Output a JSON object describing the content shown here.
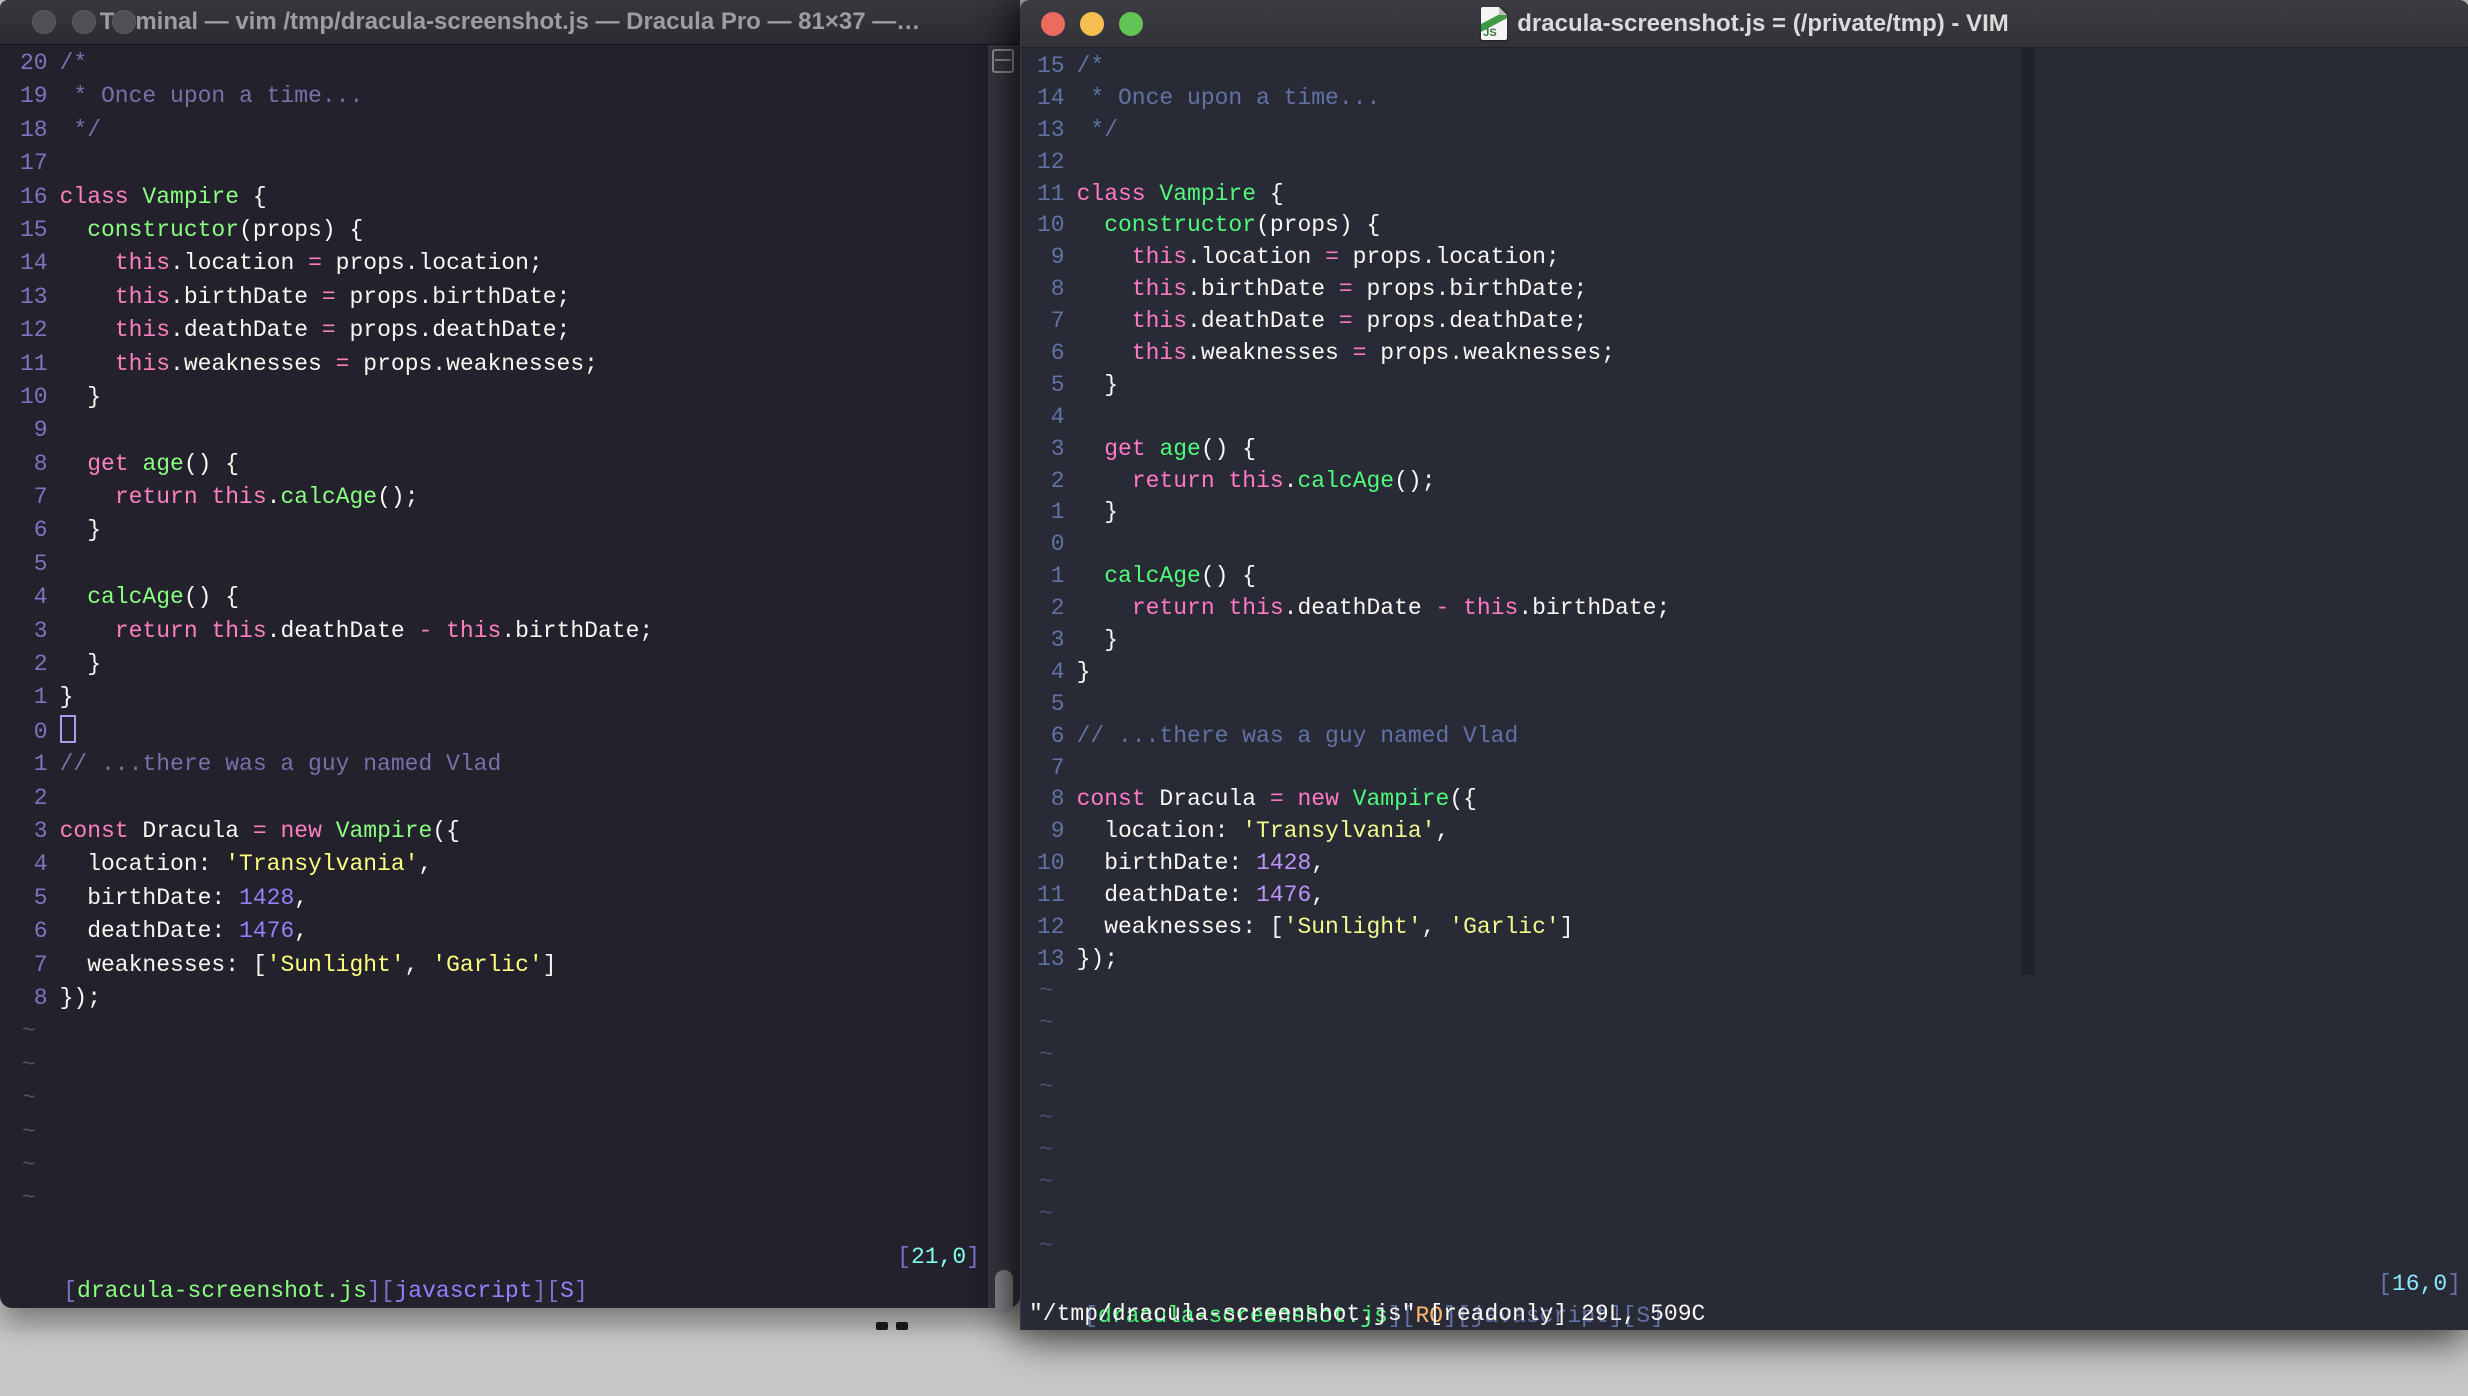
{
  "desktop": {
    "background_color": "#C9C7C5"
  },
  "shared_code": {
    "lines": [
      [
        [
          "comment",
          "/*"
        ]
      ],
      [
        [
          "comment",
          " * Once upon a time..."
        ]
      ],
      [
        [
          "comment",
          " */"
        ]
      ],
      [],
      [
        [
          "kw",
          "class"
        ],
        [
          "fg",
          " "
        ],
        [
          "fn",
          "Vampire"
        ],
        [
          "fg",
          " {"
        ]
      ],
      [
        [
          "fg",
          "  "
        ],
        [
          "fn",
          "constructor"
        ],
        [
          "fg",
          "(props) {"
        ]
      ],
      [
        [
          "fg",
          "    "
        ],
        [
          "kw",
          "this"
        ],
        [
          "fg",
          ".location "
        ],
        [
          "kw",
          "="
        ],
        [
          "fg",
          " props.location;"
        ]
      ],
      [
        [
          "fg",
          "    "
        ],
        [
          "kw",
          "this"
        ],
        [
          "fg",
          ".birthDate "
        ],
        [
          "kw",
          "="
        ],
        [
          "fg",
          " props.birthDate;"
        ]
      ],
      [
        [
          "fg",
          "    "
        ],
        [
          "kw",
          "this"
        ],
        [
          "fg",
          ".deathDate "
        ],
        [
          "kw",
          "="
        ],
        [
          "fg",
          " props.deathDate;"
        ]
      ],
      [
        [
          "fg",
          "    "
        ],
        [
          "kw",
          "this"
        ],
        [
          "fg",
          ".weaknesses "
        ],
        [
          "kw",
          "="
        ],
        [
          "fg",
          " props.weaknesses;"
        ]
      ],
      [
        [
          "fg",
          "  }"
        ]
      ],
      [],
      [
        [
          "fg",
          "  "
        ],
        [
          "kw",
          "get"
        ],
        [
          "fg",
          " "
        ],
        [
          "fn",
          "age"
        ],
        [
          "fg",
          "() {"
        ]
      ],
      [
        [
          "fg",
          "    "
        ],
        [
          "kw",
          "return"
        ],
        [
          "fg",
          " "
        ],
        [
          "kw",
          "this"
        ],
        [
          "fg",
          "."
        ],
        [
          "fn",
          "calcAge"
        ],
        [
          "fg",
          "();"
        ]
      ],
      [
        [
          "fg",
          "  }"
        ]
      ],
      [],
      [
        [
          "fg",
          "  "
        ],
        [
          "fn",
          "calcAge"
        ],
        [
          "fg",
          "() {"
        ]
      ],
      [
        [
          "fg",
          "    "
        ],
        [
          "kw",
          "return"
        ],
        [
          "fg",
          " "
        ],
        [
          "kw",
          "this"
        ],
        [
          "fg",
          ".deathDate "
        ],
        [
          "kw",
          "-"
        ],
        [
          "fg",
          " "
        ],
        [
          "kw",
          "this"
        ],
        [
          "fg",
          ".birthDate;"
        ]
      ],
      [
        [
          "fg",
          "  }"
        ]
      ],
      [
        [
          "fg",
          "}"
        ]
      ],
      [],
      [
        [
          "comment",
          "// ...there was a guy named Vlad"
        ]
      ],
      [],
      [
        [
          "kw",
          "const"
        ],
        [
          "fg",
          " Dracula "
        ],
        [
          "kw",
          "="
        ],
        [
          "fg",
          " "
        ],
        [
          "kw",
          "new"
        ],
        [
          "fg",
          " "
        ],
        [
          "fn",
          "Vampire"
        ],
        [
          "fg",
          "({"
        ]
      ],
      [
        [
          "fg",
          "  location: "
        ],
        [
          "str",
          "'Transylvania'"
        ],
        [
          "fg",
          ","
        ]
      ],
      [
        [
          "fg",
          "  birthDate: "
        ],
        [
          "num",
          "1428"
        ],
        [
          "fg",
          ","
        ]
      ],
      [
        [
          "fg",
          "  deathDate: "
        ],
        [
          "num",
          "1476"
        ],
        [
          "fg",
          ","
        ]
      ],
      [
        [
          "fg",
          "  weaknesses: ["
        ],
        [
          "str",
          "'Sunlight'"
        ],
        [
          "fg",
          ", "
        ],
        [
          "str",
          "'Garlic'"
        ],
        [
          "fg",
          "]"
        ]
      ],
      [
        [
          "fg",
          "});"
        ]
      ]
    ]
  },
  "left_window": {
    "title": "Terminal — vim /tmp/dracula-screenshot.js — Dracula Pro — 81×37 —…",
    "theme_name": "Dracula Pro",
    "traffic_light_color": "#504F56",
    "palette": {
      "bg": "#22212C",
      "fg": "#F8F8F2",
      "lnum": "#7E74C0",
      "comment": "#7970A9",
      "kw": "#FF80BF",
      "fn": "#8AFF80",
      "str": "#FFFF80",
      "num": "#9580FF",
      "tilde": "#565072",
      "cursor": "#A79DE8",
      "st_br": "#7B71C6",
      "st_file": "#8AFF80",
      "st_lang": "#9580FF",
      "st_flag": "#9580FF",
      "st_pos": "#80FFEA"
    },
    "line_numbers": [
      20,
      19,
      18,
      17,
      16,
      15,
      14,
      13,
      12,
      11,
      10,
      9,
      8,
      7,
      6,
      5,
      4,
      3,
      2,
      1,
      0,
      1,
      2,
      3,
      4,
      5,
      6,
      7,
      8
    ],
    "cursor_row": 20,
    "cursor_style": "hollow",
    "tilde_count": 6,
    "status_left": [
      [
        "br",
        "["
      ],
      [
        "file",
        "dracula-screenshot.js"
      ],
      [
        "br",
        "]["
      ],
      [
        "lang",
        "javascript"
      ],
      [
        "br",
        "]["
      ],
      [
        "flag",
        "S"
      ],
      [
        "br",
        "]"
      ]
    ],
    "status_right": [
      [
        "br",
        "["
      ],
      [
        "pos",
        "21,0"
      ],
      [
        "br",
        "]"
      ]
    ]
  },
  "right_window": {
    "title": "dracula-screenshot.js = (/private/tmp) - VIM",
    "doc_icon_label": "JS",
    "traffic_lights": {
      "close": "#EC6A5E",
      "minimize": "#F5BF4F",
      "zoom": "#61C454"
    },
    "palette": {
      "bg": "#282A36",
      "fg": "#F8F8F2",
      "lnum": "#6272A4",
      "comment": "#6272A4",
      "kw": "#FF79C6",
      "fn": "#50FA7B",
      "str": "#F1FA8C",
      "num": "#BD93F9",
      "tilde": "#4A5378",
      "cursor": "#F8F8F2",
      "st_br": "#6272A4",
      "st_file": "#50FA7B",
      "st_ro": "#FFB86C",
      "st_lang": "#6272A4",
      "st_flag": "#6272A4",
      "st_pos": "#8BE9FD"
    },
    "line_numbers": [
      15,
      14,
      13,
      12,
      11,
      10,
      9,
      8,
      7,
      6,
      5,
      4,
      3,
      2,
      1,
      0,
      1,
      2,
      3,
      4,
      5,
      6,
      7,
      8,
      9,
      10,
      11,
      12,
      13
    ],
    "cursor_row": 15,
    "cursor_style": "none",
    "tilde_count": 9,
    "status_left": [
      [
        "br",
        "["
      ],
      [
        "file",
        "dracula-screenshot.js"
      ],
      [
        "br",
        "]["
      ],
      [
        "ro",
        "RO"
      ],
      [
        "br",
        "]["
      ],
      [
        "lang",
        "javascript"
      ],
      [
        "br",
        "]["
      ],
      [
        "flag",
        "S"
      ],
      [
        "br",
        "]"
      ]
    ],
    "status_right": [
      [
        "br",
        "["
      ],
      [
        "pos",
        "16,0"
      ],
      [
        "br",
        "]"
      ]
    ],
    "command_line": "\"/tmp/dracula-screenshot.js\" [readonly] 29L, 509C"
  }
}
